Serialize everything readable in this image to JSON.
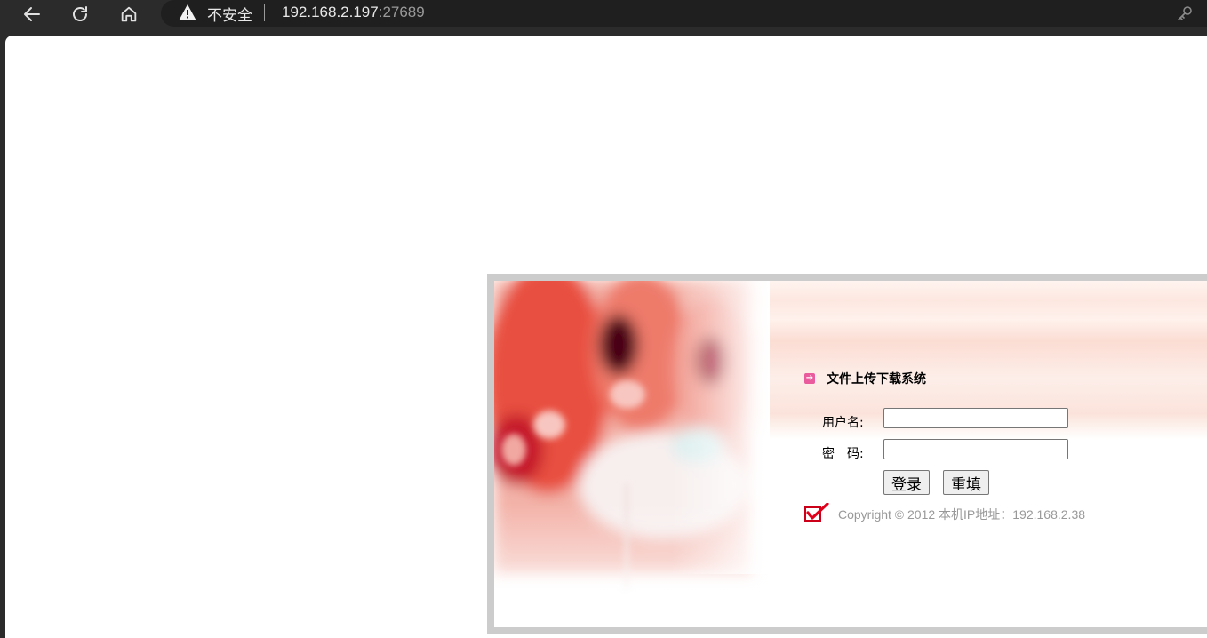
{
  "browser": {
    "security_label": "不安全",
    "url_host": "192.168.2.197",
    "url_port": ":27689",
    "icons": [
      "back-arrow-icon",
      "reload-icon",
      "home-icon",
      "warning-icon",
      "key-icon"
    ]
  },
  "login": {
    "title": "文件上传下载系统",
    "username_label": "用户名:",
    "username_value": "",
    "password_label": "密　码:",
    "password_value": "",
    "login_button": "登录",
    "reset_button": "重填",
    "copyright": "Copyright © 2012 本机IP地址：192.168.2.38"
  },
  "colors": {
    "frame_border": "#cccccc",
    "title_arrow": "#e95b9c",
    "copyright_text": "#999999",
    "check_mark": "#e0001b"
  }
}
